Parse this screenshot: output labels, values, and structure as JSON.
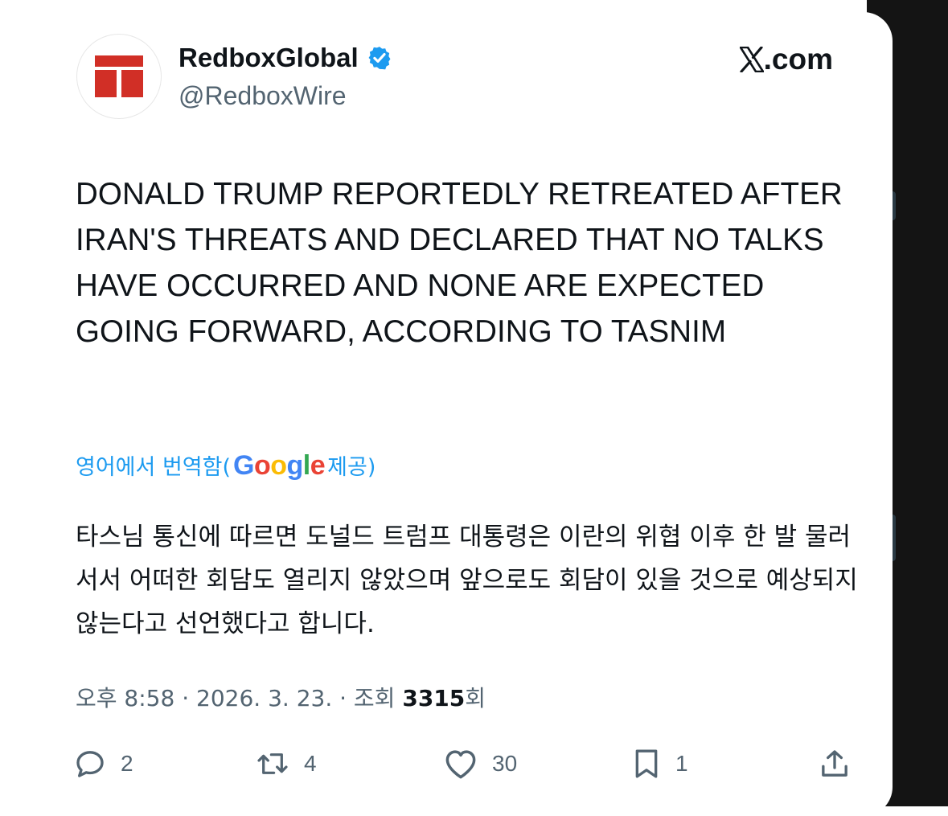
{
  "author": {
    "display_name": "RedboxGlobal",
    "handle": "@RedboxWire",
    "verified_icon": "verified-badge-icon",
    "avatar_icon": "redbox-logo-icon"
  },
  "brand": {
    "label": ".com",
    "icon": "x-logo-icon"
  },
  "post": {
    "text": "DONALD TRUMP REPORTEDLY RETREATED AFTER IRAN'S THREATS AND DECLARED THAT NO TALKS HAVE OCCURRED AND NONE ARE EXPECTED GOING FORWARD, ACCORDING TO TASNIM"
  },
  "translation": {
    "prefix": "영어에서 번역함(",
    "google_label": "Google",
    "suffix": " 제공)",
    "text": "타스님 통신에 따르면 도널드 트럼프 대통령은 이란의 위협 이후 한 발 물러서서 어떠한 회담도 열리지 않았으며 앞으로도 회담이 있을 것으로 예상되지 않는다고 선언했다고 합니다."
  },
  "meta": {
    "time": "오후 8:58",
    "separator": " · ",
    "date": "2026. 3. 23.",
    "views_prefix": "조회 ",
    "views_count": "3315",
    "views_suffix": "회"
  },
  "actions": {
    "reply_count": "2",
    "repost_count": "4",
    "like_count": "30",
    "bookmark_count": "1"
  },
  "colors": {
    "accent": "#1d9bf0",
    "text": "#0f1419",
    "secondary": "#536471",
    "logo_red": "#d12f26"
  }
}
